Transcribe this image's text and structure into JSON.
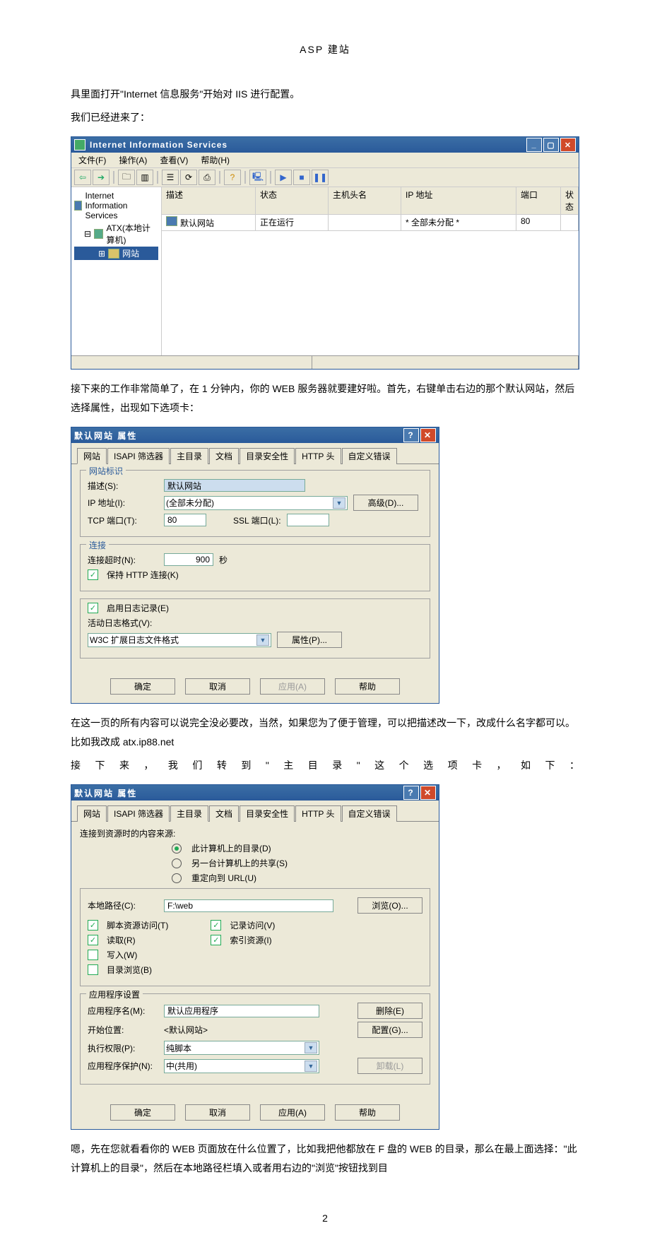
{
  "doc": {
    "header": "ASP 建站",
    "para1": "具里面打开\"Internet 信息服务\"开始对 IIS 进行配置。",
    "para2": "我们已经进来了：",
    "para3": "接下来的工作非常简单了，在 1 分钟内，你的 WEB 服务器就要建好啦。首先，右键单击右边的那个默认网站，然后选择属性，出现如下选项卡：",
    "para4": "在这一页的所有内容可以说完全没必要改，当然，如果您为了便于管理，可以把描述改一下，改成什么名字都可以。比如我改成 atx.ip88.net",
    "para5": "接下来，我们转到\"主目录\"这个选项卡，如下：",
    "para6": "嗯，先在您就看看你的 WEB 页面放在什么位置了，比如我把他都放在 F 盘的 WEB 的目录，那么在最上面选择：\"此计算机上的目录\"，然后在本地路径栏填入或者用右边的\"浏览\"按钮找到目",
    "page_num": "2"
  },
  "iis": {
    "title": "Internet Information Services",
    "menus": [
      "文件(F)",
      "操作(A)",
      "查看(V)",
      "帮助(H)"
    ],
    "tree": {
      "root": "Internet Information Services",
      "computer": "ATX(本地计算机)",
      "websites": "网站"
    },
    "columns": [
      "描述",
      "状态",
      "主机头名",
      "IP 地址",
      "端口",
      "状态"
    ],
    "row": {
      "desc": "默认网站",
      "status": "正在运行",
      "host": "",
      "ip": "* 全部未分配 *",
      "port": "80"
    }
  },
  "dlg": {
    "title": "默认网站 属性",
    "tabs": [
      "网站",
      "ISAPI 筛选器",
      "主目录",
      "文档",
      "目录安全性",
      "HTTP 头",
      "自定义错误"
    ],
    "ok": "确定",
    "cancel": "取消",
    "apply": "应用(A)",
    "help": "帮助"
  },
  "dlg1": {
    "groups": [
      "网站标识",
      "连接"
    ],
    "desc_label": "描述(S):",
    "desc_value": "默认网站",
    "ip_label": "IP 地址(I):",
    "ip_value": "(全部未分配)",
    "advanced": "高级(D)...",
    "tcp_label": "TCP 端口(T):",
    "tcp_value": "80",
    "ssl_label": "SSL 端口(L):",
    "timeout_label": "连接超时(N):",
    "timeout_value": "900",
    "seconds": "秒",
    "keepalive": "保持 HTTP 连接(K)",
    "enable_log": "启用日志记录(E)",
    "logformat_label": "活动日志格式(V):",
    "logformat_value": "W3C 扩展日志文件格式",
    "logprops": "属性(P)..."
  },
  "dlg2": {
    "source_label": "连接到资源时的内容来源:",
    "radios": [
      "此计算机上的目录(D)",
      "另一台计算机上的共享(S)",
      "重定向到 URL(U)"
    ],
    "localpath_label": "本地路径(C):",
    "localpath_value": "F:\\web",
    "browse": "浏览(O)...",
    "checks": [
      "脚本资源访问(T)",
      "读取(R)",
      "写入(W)",
      "目录浏览(B)",
      "记录访问(V)",
      "索引资源(I)"
    ],
    "appsettings": "应用程序设置",
    "appname_label": "应用程序名(M):",
    "appname_value": "默认应用程序",
    "remove": "删除(E)",
    "startpos_label": "开始位置:",
    "startpos_value": "<默认网站>",
    "config": "配置(G)...",
    "execperm_label": "执行权限(P):",
    "execperm_value": "纯脚本",
    "appprotect_label": "应用程序保护(N):",
    "appprotect_value": "中(共用)",
    "unload": "卸载(L)"
  }
}
